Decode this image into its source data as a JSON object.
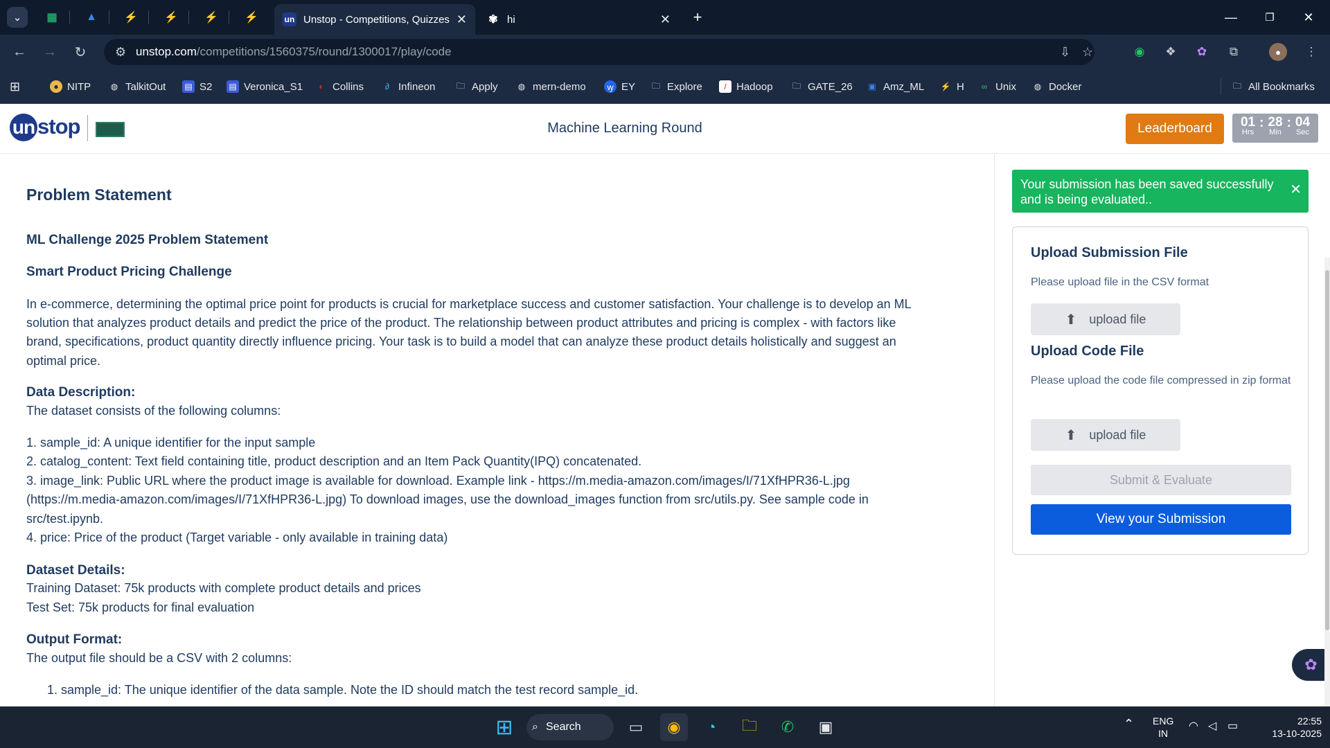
{
  "browser": {
    "tabs": [
      {
        "title": "Unstop - Competitions, Quizzes",
        "favicon": "un",
        "active": true
      },
      {
        "title": "hi",
        "favicon": "openai-icon",
        "active": false
      }
    ],
    "url_host": "unstop.com",
    "url_path": "/competitions/1560375/round/1300017/play/code"
  },
  "bookmarks": [
    {
      "label": "NITP",
      "icon": "circle"
    },
    {
      "label": "TalkitOut",
      "icon": "github"
    },
    {
      "label": "S2",
      "icon": "grid"
    },
    {
      "label": "Veronica_S1",
      "icon": "grid"
    },
    {
      "label": "Collins",
      "icon": "circle"
    },
    {
      "label": "Infineon",
      "icon": "link"
    },
    {
      "label": "Apply",
      "icon": "folder"
    },
    {
      "label": "mern-demo",
      "icon": "github"
    },
    {
      "label": "EY",
      "icon": "circle"
    },
    {
      "label": "Explore",
      "icon": "folder"
    },
    {
      "label": "Hadoop",
      "icon": "square"
    },
    {
      "label": "GATE_26",
      "icon": "folder"
    },
    {
      "label": "Amz_ML",
      "icon": "square"
    },
    {
      "label": "H",
      "icon": "bolt"
    },
    {
      "label": "Unix",
      "icon": "infinity"
    },
    {
      "label": "Docker",
      "icon": "github"
    }
  ],
  "all_bookmarks": "All Bookmarks",
  "header": {
    "logo": "unstop",
    "round_title": "Machine Learning Round",
    "leaderboard": "Leaderboard",
    "timer": {
      "hrs": "01",
      "min": "28",
      "sec": "04",
      "hrs_label": "Hrs",
      "min_label": "Min",
      "sec_label": "Sec"
    }
  },
  "content": {
    "heading": "Problem Statement",
    "challenge_title": "ML Challenge 2025 Problem Statement",
    "subtitle": "Smart Product Pricing Challenge",
    "intro": [
      "In e-commerce, determining the optimal price point for products is crucial for marketplace success and customer satisfaction. Your challenge is to develop an ML",
      "solution that analyzes product details and predict the price of the product. The relationship between product attributes and pricing is complex - with factors like",
      "brand, specifications, product quantity directly influence pricing. Your task is to build a model that can analyze these product details holistically and suggest an",
      "optimal price."
    ],
    "data_desc_heading": "Data Description:",
    "data_desc_intro": "The dataset consists of the following columns:",
    "columns": [
      "1. sample_id: A unique identifier for the input sample",
      "2. catalog_content: Text field containing title, product description and an Item Pack Quantity(IPQ) concatenated.",
      "3. image_link: Public URL where the product image is available for download. Example link - https://m.media-amazon.com/images/I/71XfHPR36-L.jpg",
      "(https://m.media-amazon.com/images/I/71XfHPR36-L.jpg) To download images, use the download_images function from src/utils.py. See sample code in",
      "src/test.ipynb.",
      "4. price: Price of the product (Target variable - only available in training data)"
    ],
    "dataset_details_heading": "Dataset Details:",
    "dataset_details": [
      "Training Dataset: 75k products with complete product details and prices",
      "Test Set: 75k products for final evaluation"
    ],
    "output_heading": "Output Format:",
    "output_intro": "The output file should be a CSV with 2 columns:",
    "output_items": [
      "1. sample_id: The unique identifier of the data sample. Note the ID should match the test record sample_id."
    ]
  },
  "panel": {
    "toast": "Your submission has been saved successfully and is being evaluated..",
    "upload_submission_title": "Upload Submission File",
    "upload_submission_hint": "Please upload file in the CSV format",
    "upload_label": "upload file",
    "upload_code_title": "Upload Code File",
    "upload_code_hint": "Please upload the code file compressed in zip format",
    "submit": "Submit & Evaluate",
    "view": "View your Submission"
  },
  "taskbar": {
    "search": "Search",
    "lang": "ENG",
    "region": "IN",
    "time": "22:55",
    "date": "13-10-2025"
  },
  "colors": {
    "accent": "#0b5ddd",
    "leaderboard": "#e07a12",
    "toast": "#16b55e",
    "text": "#1e3a5f"
  }
}
